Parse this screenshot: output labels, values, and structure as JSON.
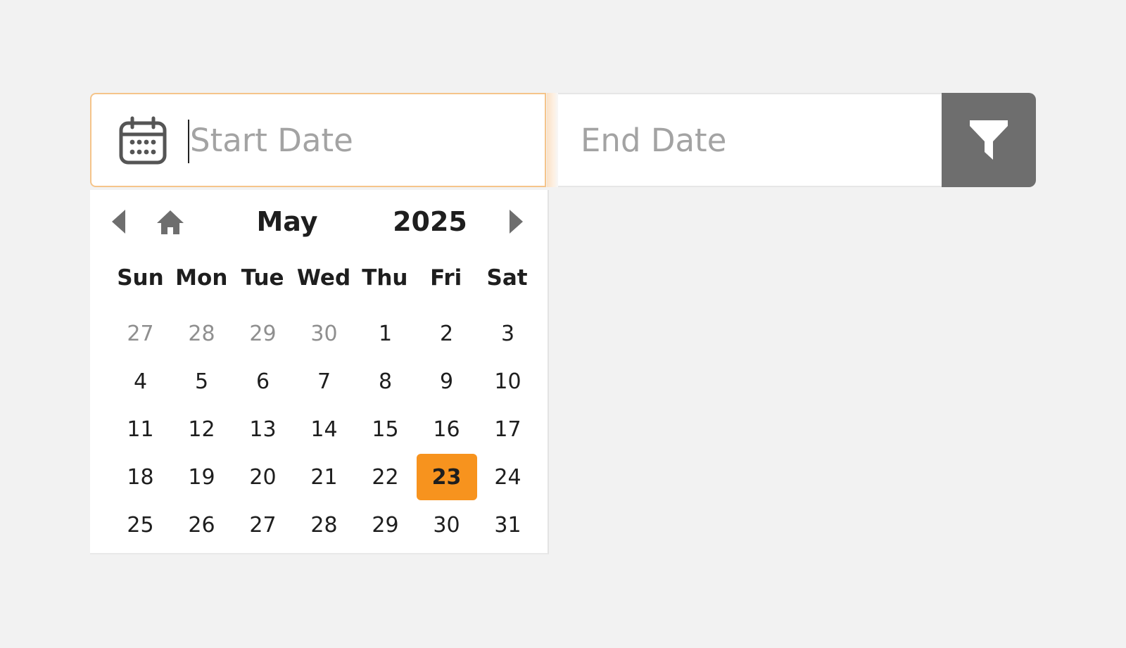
{
  "range_bar": {
    "start_field": {
      "placeholder": "Start Date",
      "value": "",
      "icon": "calendar-icon"
    },
    "end_field": {
      "placeholder": "End Date",
      "value": ""
    },
    "filter_button": {
      "icon": "filter-icon",
      "color": "#6e6e6e"
    },
    "focus_color": "#f5c48a"
  },
  "calendar": {
    "month": "May",
    "year": "2025",
    "nav": {
      "prev_icon": "triangle-left-icon",
      "home_icon": "home-icon",
      "next_icon": "triangle-right-icon"
    },
    "weekdays": [
      "Sun",
      "Mon",
      "Tue",
      "Wed",
      "Thu",
      "Fri",
      "Sat"
    ],
    "selected_day": "23",
    "selected_color": "#f7931e",
    "weeks": [
      [
        "27",
        "28",
        "29",
        "30",
        "1",
        "2",
        "3"
      ],
      [
        "4",
        "5",
        "6",
        "7",
        "8",
        "9",
        "10"
      ],
      [
        "11",
        "12",
        "13",
        "14",
        "15",
        "16",
        "17"
      ],
      [
        "18",
        "19",
        "20",
        "21",
        "22",
        "23",
        "24"
      ],
      [
        "25",
        "26",
        "27",
        "28",
        "29",
        "30",
        "31"
      ]
    ],
    "previous_month_days": [
      "27",
      "28",
      "29",
      "30"
    ]
  }
}
